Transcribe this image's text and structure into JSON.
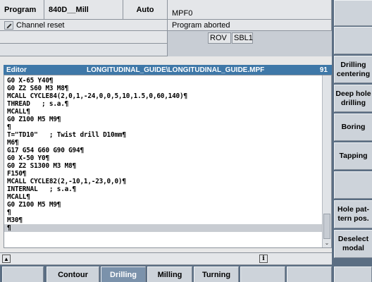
{
  "header": {
    "program_label": "Program",
    "channel_name": "840D__Mill",
    "mode": "Auto",
    "program_name": "MPF0",
    "channel_status": "Channel reset",
    "program_status": "Program aborted",
    "flags": [
      "ROV",
      "SBL1"
    ]
  },
  "editor": {
    "label": "Editor",
    "path": "LONGITUDINAL_GUIDE\\LONGITUDINAL_GUIDE.MPF",
    "line_count": "91",
    "lines": [
      "G0 X-65 Y40¶",
      "G0 Z2 S60 M3 M8¶",
      "MCALL CYCLE84(2,0,1,-24,0,0,5,10,1.5,0,60,140)¶",
      "THREAD   ; s.a.¶",
      "MCALL¶",
      "G0 Z100 M5 M9¶",
      "¶",
      "T=\"TD10\"   ; Twist drill D10mm¶",
      "M6¶",
      "G17 G54 G60 G90 G94¶",
      "G0 X-50 Y0¶",
      "G0 Z2 S1300 M3 M8¶",
      "F150¶",
      "MCALL CYCLE82(2,-10,1,-23,0,0)¶",
      "INTERNAL   ; s.a.¶",
      "MCALL¶",
      "G0 Z100 M5 M9¶",
      "¶",
      "M30¶",
      "¶"
    ],
    "highlighted_line": 19
  },
  "vertical_softkeys": [
    "",
    "",
    "Drilling centering",
    "Deep hole drilling",
    "Boring",
    "Tapping",
    "",
    "Hole pat-tern pos.",
    "Deselect modal"
  ],
  "horizontal_softkeys": [
    {
      "label": "",
      "active": false
    },
    {
      "label": "Contour",
      "active": false
    },
    {
      "label": "Drilling",
      "active": true
    },
    {
      "label": "Milling",
      "active": false
    },
    {
      "label": "Turning",
      "active": false
    },
    {
      "label": "",
      "active": false
    },
    {
      "label": "",
      "active": false
    },
    {
      "label": "",
      "active": false
    }
  ],
  "icons": {
    "scroll_up": "▲",
    "scroll_down": "⌄",
    "info": "i"
  }
}
